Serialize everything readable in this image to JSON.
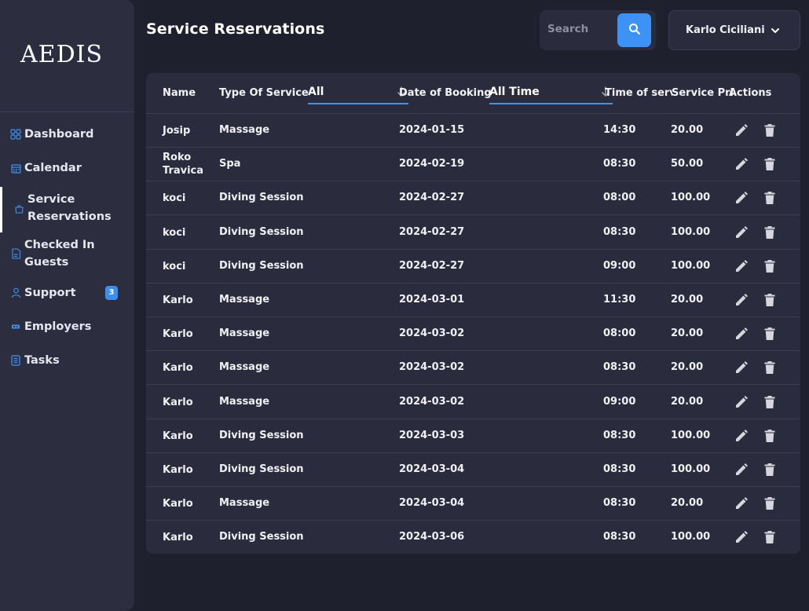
{
  "brand": {
    "logo_text": "AEDIS"
  },
  "sidebar": {
    "items": [
      {
        "label": "Dashboard",
        "icon": "grid-icon"
      },
      {
        "label": "Calendar",
        "icon": "calendar-icon"
      },
      {
        "label": "Service Reservations",
        "icon": "bag-icon",
        "active": true
      },
      {
        "label": "Checked In Guests",
        "icon": "document-icon"
      },
      {
        "label": "Support",
        "icon": "person-icon",
        "badge": "3"
      },
      {
        "label": "Employers",
        "icon": "id-card-icon"
      },
      {
        "label": "Tasks",
        "icon": "list-icon"
      }
    ]
  },
  "header": {
    "title": "Service Reservations",
    "search_placeholder": "Search",
    "user_name": "Karlo Ciciliani"
  },
  "table": {
    "columns": {
      "name": "Name",
      "type": "Type Of Service",
      "type_filter": "All",
      "date": "Date of Booking",
      "date_filter": "All Time",
      "time": "Time of service",
      "price": "Service Price",
      "actions": "Actions"
    },
    "rows": [
      {
        "name": "Josip",
        "type": "Massage",
        "date": "2024-01-15",
        "time": "14:30",
        "price": "20.00"
      },
      {
        "name": "Roko Travica",
        "type": "Spa",
        "date": "2024-02-19",
        "time": "08:30",
        "price": "50.00"
      },
      {
        "name": "koci",
        "type": "Diving Session",
        "date": "2024-02-27",
        "time": "08:00",
        "price": "100.00"
      },
      {
        "name": "koci",
        "type": "Diving Session",
        "date": "2024-02-27",
        "time": "08:30",
        "price": "100.00"
      },
      {
        "name": "koci",
        "type": "Diving Session",
        "date": "2024-02-27",
        "time": "09:00",
        "price": "100.00"
      },
      {
        "name": "Karlo",
        "type": "Massage",
        "date": "2024-03-01",
        "time": "11:30",
        "price": "20.00"
      },
      {
        "name": "Karlo",
        "type": "Massage",
        "date": "2024-03-02",
        "time": "08:00",
        "price": "20.00"
      },
      {
        "name": "Karlo",
        "type": "Massage",
        "date": "2024-03-02",
        "time": "08:30",
        "price": "20.00"
      },
      {
        "name": "Karlo",
        "type": "Massage",
        "date": "2024-03-02",
        "time": "09:00",
        "price": "20.00"
      },
      {
        "name": "Karlo",
        "type": "Diving Session",
        "date": "2024-03-03",
        "time": "08:30",
        "price": "100.00"
      },
      {
        "name": "Karlo",
        "type": "Diving Session",
        "date": "2024-03-04",
        "time": "08:30",
        "price": "100.00"
      },
      {
        "name": "Karlo",
        "type": "Massage",
        "date": "2024-03-04",
        "time": "08:30",
        "price": "20.00"
      },
      {
        "name": "Karlo",
        "type": "Diving Session",
        "date": "2024-03-06",
        "time": "08:30",
        "price": "100.00"
      }
    ]
  },
  "colors": {
    "accent": "#3d93f5",
    "background": "#1f202d",
    "panel": "#2a2c3d",
    "sidebar": "#2c2e40"
  }
}
